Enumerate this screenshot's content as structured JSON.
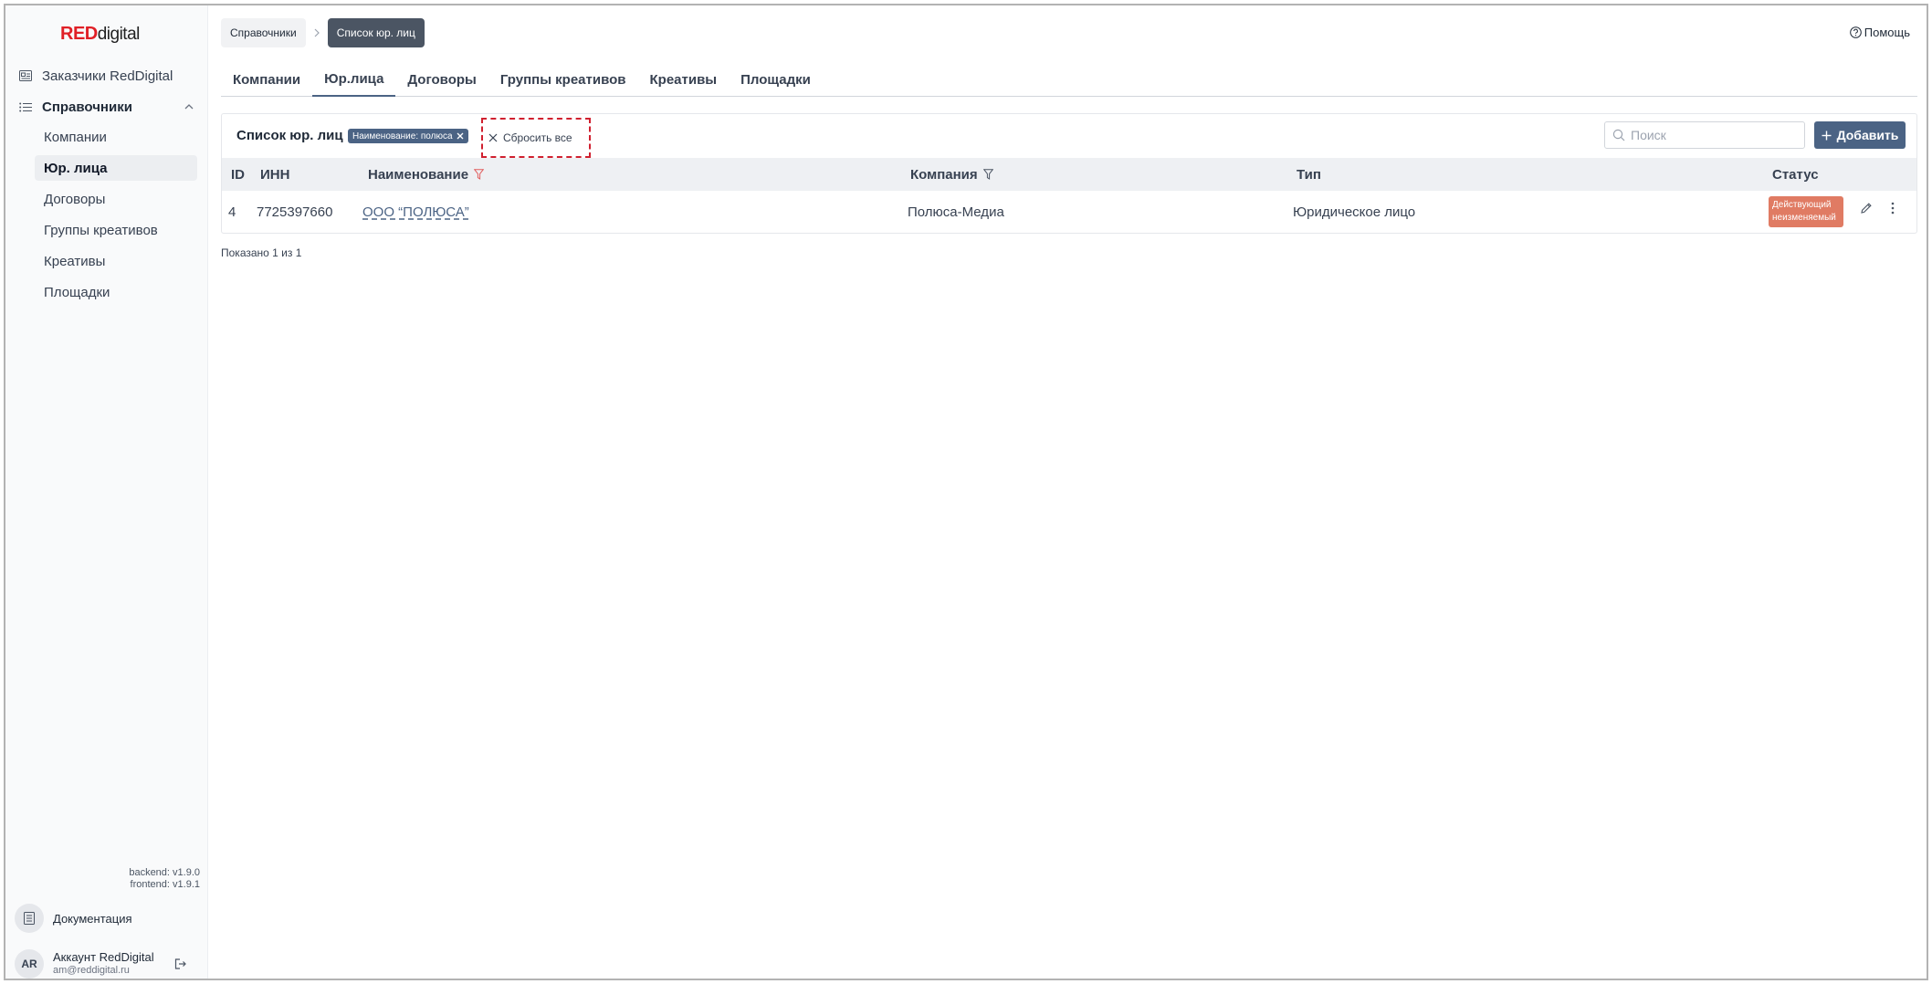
{
  "logo": {
    "part1": "RED",
    "part2": "digital"
  },
  "sidebar": {
    "top_item": "Заказчики RedDigital",
    "group": "Справочники",
    "items": [
      {
        "label": "Компании",
        "active": false
      },
      {
        "label": "Юр. лица",
        "active": true
      },
      {
        "label": "Договоры",
        "active": false
      },
      {
        "label": "Группы креативов",
        "active": false
      },
      {
        "label": "Креативы",
        "active": false
      },
      {
        "label": "Площадки",
        "active": false
      }
    ],
    "backend_version": "backend: v1.9.0",
    "frontend_version": "frontend: v1.9.1",
    "docs_label": "Документация",
    "account": {
      "initials": "AR",
      "name": "Аккаунт RedDigital",
      "email": "am@reddigital.ru"
    }
  },
  "breadcrumbs": [
    "Справочники",
    "Список юр. лиц"
  ],
  "help_label": "Помощь",
  "tabs": [
    "Компании",
    "Юр.лица",
    "Договоры",
    "Группы креативов",
    "Креативы",
    "Площадки"
  ],
  "active_tab": "Юр.лица",
  "list": {
    "title": "Список юр. лиц",
    "filter_chip": "Наименование: полюса",
    "reset_label": "Сбросить все",
    "search_placeholder": "Поиск",
    "add_label": "Добавить",
    "columns": [
      "ID",
      "ИНН",
      "Наименование",
      "Компания",
      "Тип",
      "Статус"
    ],
    "rows": [
      {
        "id": "4",
        "inn": "7725397660",
        "name": "ООО “ПОЛЮСА”",
        "company": "Полюса-Медиа",
        "type": "Юридическое лицо",
        "status_line1": "Действующий",
        "status_line2": "неизменяемый"
      }
    ],
    "shown_text": "Показано 1 из 1"
  },
  "colors": {
    "accent": "#4b6384",
    "brand_red": "#e01f26",
    "status_badge": "#e07b63",
    "filter_active": "#e05c5c"
  }
}
